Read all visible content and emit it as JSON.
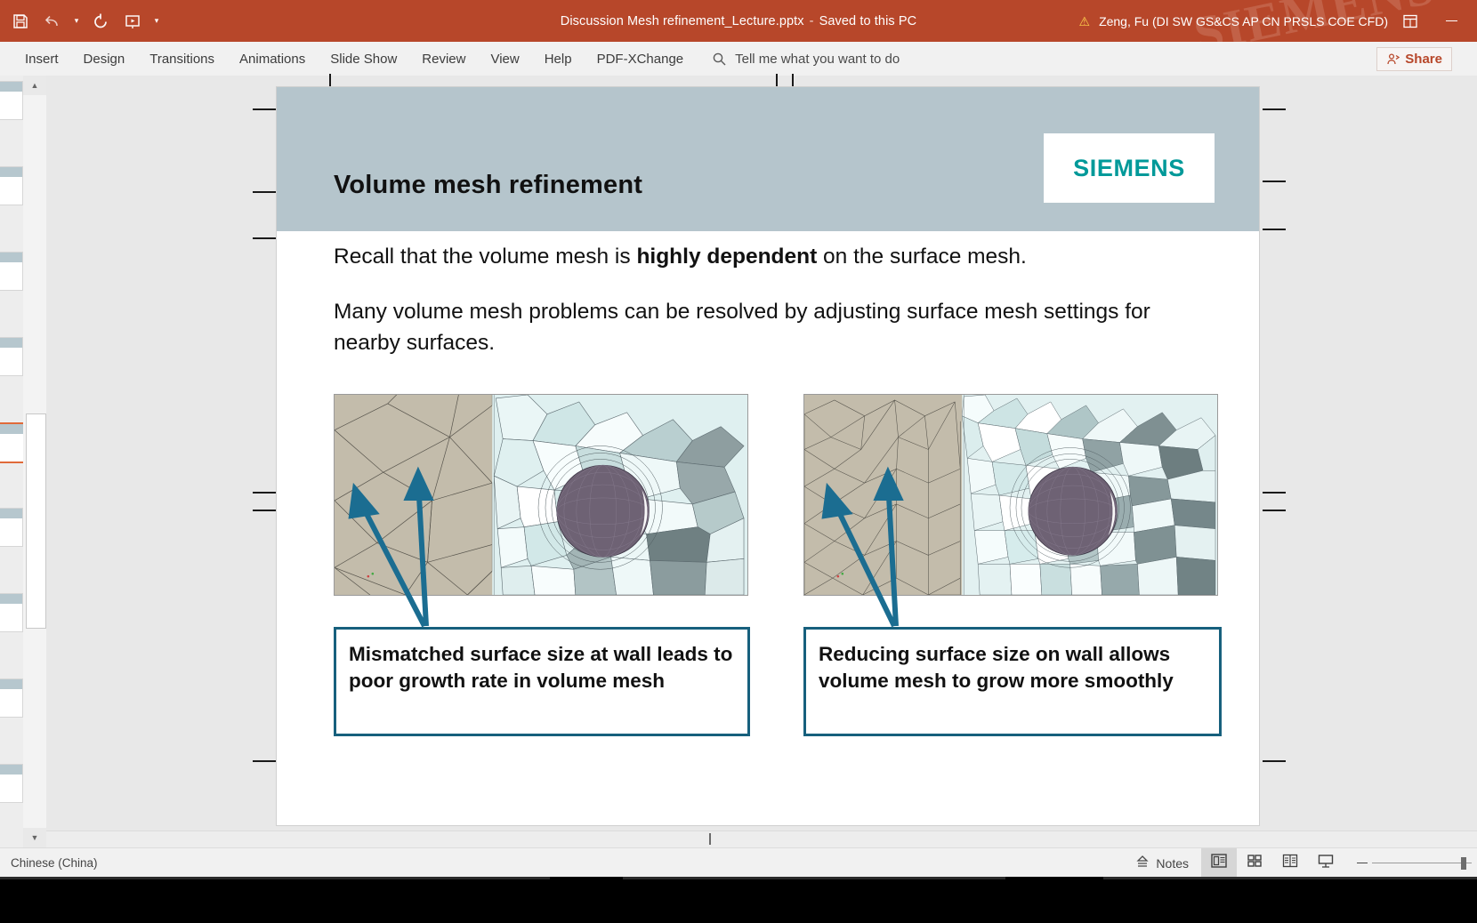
{
  "titlebar": {
    "document_title": "Discussion Mesh refinement_Lecture.pptx",
    "separator": "-",
    "save_state": "Saved to this PC",
    "user_account": "Zeng, Fu (DI SW GS&CS AP CN PRSLS COE CFD)",
    "warning_icon": "warning-triangle-icon",
    "quick_access": [
      {
        "name": "save-icon",
        "label": "Save"
      },
      {
        "name": "undo-icon",
        "label": "Undo"
      },
      {
        "name": "redo-icon",
        "label": "Redo"
      },
      {
        "name": "start-presentation-icon",
        "label": "Start From Beginning"
      },
      {
        "name": "customize-qat-icon",
        "label": "Customize Quick Access Toolbar"
      }
    ],
    "ribbon_display_icon": "ribbon-display-options-icon",
    "minimize_icon": "minimize-icon",
    "watermark_text": "SIEMENS"
  },
  "ribbon": {
    "tabs": [
      {
        "label": "Insert"
      },
      {
        "label": "Design"
      },
      {
        "label": "Transitions"
      },
      {
        "label": "Animations"
      },
      {
        "label": "Slide Show"
      },
      {
        "label": "Review"
      },
      {
        "label": "View"
      },
      {
        "label": "Help"
      },
      {
        "label": "PDF-XChange"
      }
    ],
    "tell_me": {
      "icon": "search-icon",
      "placeholder": "Tell me what you want to do"
    },
    "share": {
      "label": "Share",
      "icon": "share-person-icon"
    }
  },
  "thumbnails": {
    "selected_index": 4,
    "count": 9,
    "scroll_up_icon": "chevron-up-icon",
    "scroll_down_icon": "chevron-down-icon"
  },
  "slide": {
    "title": "Volume mesh refinement",
    "logo_text": "SIEMENS",
    "logo_color": "#009999",
    "header_color": "#b5c5cc",
    "paragraphs": [
      {
        "parts": [
          {
            "text": "Recall that the volume mesh is ",
            "bold": false
          },
          {
            "text": "highly dependent",
            "bold": true
          },
          {
            "text": " on the surface mesh.",
            "bold": false
          }
        ]
      },
      {
        "parts": [
          {
            "text": "Many volume mesh problems can be resolved by adjusting surface mesh settings for nearby surfaces.",
            "bold": false
          }
        ]
      }
    ],
    "images": [
      {
        "name": "mesh-image-mismatched",
        "alt": "Volume mesh cross-section with mismatched surface size"
      },
      {
        "name": "mesh-image-reduced",
        "alt": "Volume mesh cross-section with reduced surface size"
      }
    ],
    "callouts": [
      {
        "name": "callout-left",
        "text": "Mismatched surface size at wall leads to poor growth rate in volume mesh",
        "border_color": "#17607d"
      },
      {
        "name": "callout-right",
        "text": "Reducing surface size on wall allows volume mesh to grow more smoothly",
        "border_color": "#17607d"
      }
    ],
    "arrow_color": "#1b6d91"
  },
  "statusbar": {
    "language": "Chinese (China)",
    "notes": {
      "label": "Notes",
      "icon": "notes-icon"
    },
    "views": [
      {
        "name": "view-normal",
        "icon": "normal-view-icon",
        "active": true
      },
      {
        "name": "view-slide-sorter",
        "icon": "slide-sorter-icon",
        "active": false
      },
      {
        "name": "view-reading",
        "icon": "reading-view-icon",
        "active": false
      },
      {
        "name": "view-slideshow",
        "icon": "slideshow-view-icon",
        "active": false
      }
    ],
    "zoom": {
      "minus_icon": "zoom-out-icon",
      "handle": "zoom-slider-handle"
    }
  }
}
